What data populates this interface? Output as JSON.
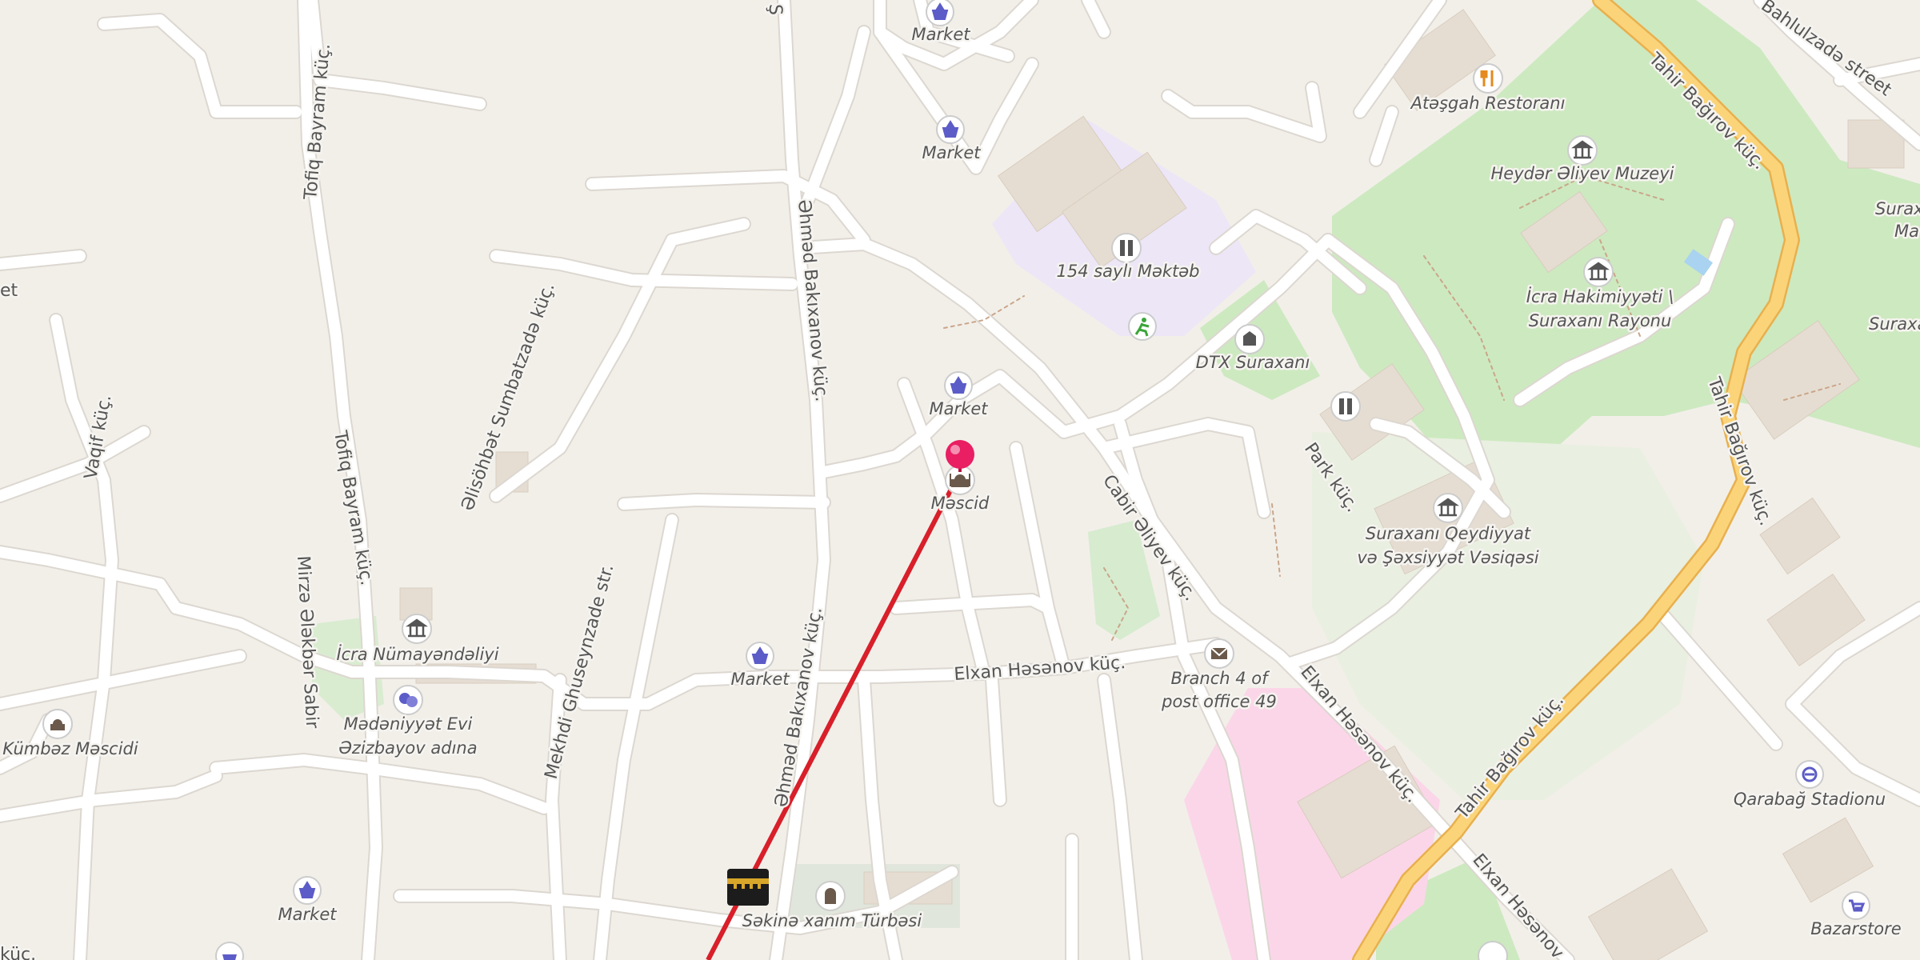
{
  "map": {
    "streets": [
      "Tofiq Bayram küç.",
      "Tofiq Bayram küç.",
      "Əlisöhbət Sumbatzadə küç.",
      "Əhməd Bakıxanov küç.",
      "Əhməd Bakıxanov küç.",
      "Mekhdi Ghuseynzade str.",
      "Vaqif küç.",
      "Mirzə Ələkbər Sabir",
      "Elxan Həsənov küç.",
      "Elxan Həsənov küç.",
      "Elxan Həsənov",
      "Cabir Əliyev küç.",
      "Park küç.",
      "Tahir Bağırov küç.",
      "Tahir Bağırov küç.",
      "Tahir Bağırov küç.",
      "Bahlulzadə street",
      "küç.",
      "et",
      "Ş"
    ],
    "pois": {
      "market_1": "Market",
      "market_2": "Market",
      "market_3": "Market",
      "market_4": "Market",
      "market_5": "Market",
      "mosque": "Məscid",
      "school": "154 saylı Məktəb",
      "dtx": "DTX Suraxanı",
      "restaurant": "Atəşgah Restoranı",
      "museum": "Heydər Əliyev Muzeyi",
      "icra_1": "İcra Hakimiyyəti \\",
      "icra_2": "Suraxanı Rayonu",
      "registry_1": "Suraxanı Qeydiyyat",
      "registry_2": "və Şəxsiyyət Vəsiqəsi",
      "post_1": "Branch 4 of",
      "post_2": "post office 49",
      "icra_numa": "İcra Nümayəndəliyi",
      "culture_1": "Mədəniyyət Evi",
      "culture_2": "Əzizbayov adına",
      "kumbaz": "Kümbəz Məscidi",
      "turbe": "Səkinə xanım Türbəsi",
      "stadium": "Qarabağ Stadionu",
      "bazarstore": "Bazarstore",
      "surax_1": "Suraxı",
      "surax_2": "Ma",
      "surax_3": "Suraxa"
    }
  },
  "colors": {
    "background": "#f2efe9",
    "road": "#ffffff",
    "road_casing": "#dcd7d0",
    "major_road": "#fbd47a",
    "major_road_casing": "#e8b04e",
    "park": "#cde9c0",
    "school_area": "#ece6f7",
    "hospital_area": "#fbd6e8",
    "building": "#e6ddd2",
    "qibla_line": "#d81f2a",
    "pin": "#e91e63",
    "market_icon": "#5c5cc8"
  },
  "icons": {
    "pin": "location-pin-icon",
    "kaaba": "kaaba-icon",
    "market": "shopping-basket-icon",
    "mosque": "mosque-icon"
  }
}
